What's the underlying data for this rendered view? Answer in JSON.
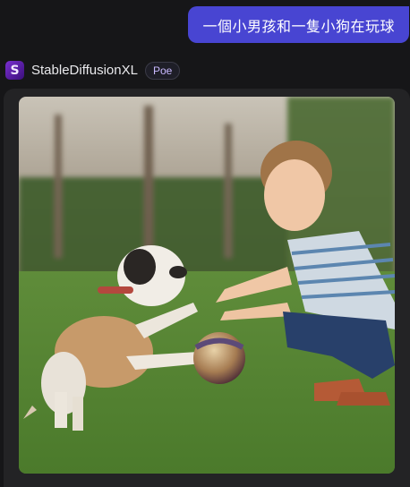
{
  "user_message": {
    "text": "一個小男孩和一隻小狗在玩球"
  },
  "bot": {
    "avatar_letter": "S",
    "name": "StableDiffusionXL",
    "badge": "Poe"
  },
  "generated_image": {
    "subject": "generated-photo"
  },
  "colors": {
    "background": "#161618",
    "user_bubble": "#4845d2",
    "card": "#232325",
    "avatar": "#6a22c2"
  }
}
